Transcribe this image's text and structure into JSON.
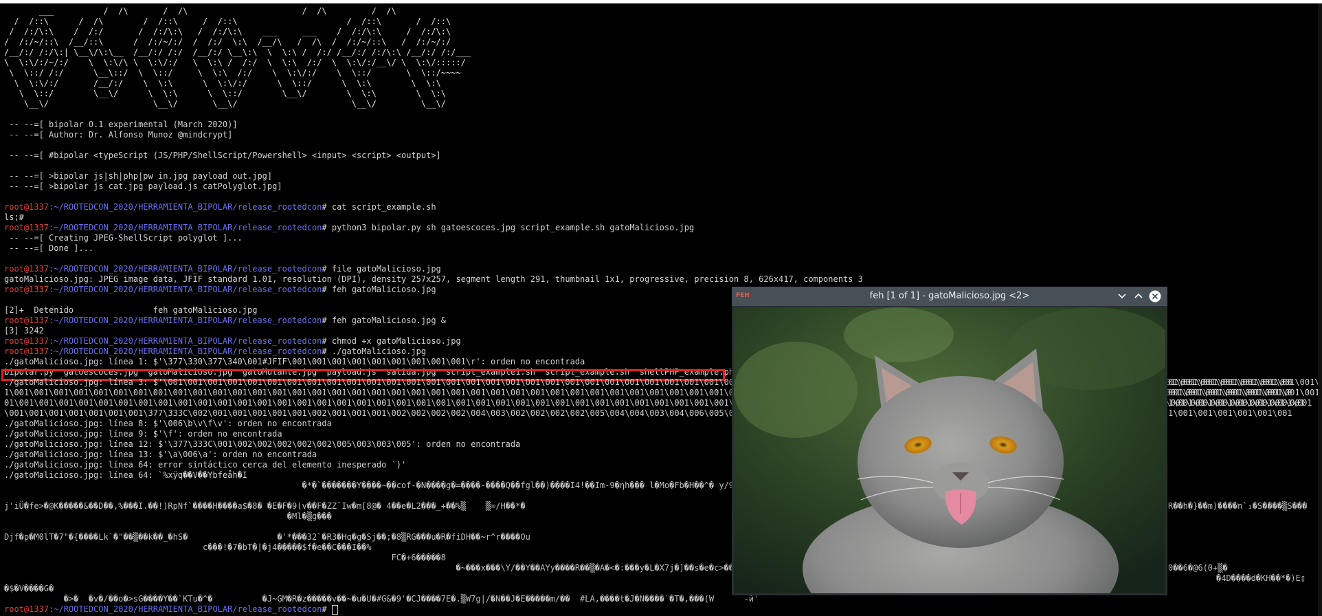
{
  "terminal": {
    "banner": [
      "       ___          /  /\\       /  /\\                       /  /\\         /  /\\",
      "  /  /::\\      /  /\\        /  /::\\     /  /::\\                      /  /::\\       /  /::\\",
      " /  /:/\\:\\    /  /:/       /  /:/\\:\\   /  /:/\\:\\    ___     ___    /  /:/\\:\\     /  /:/\\:\\",
      "/  /:/~/::\\  /__/::\\      /  /:/~/:/  /  /:/  \\:\\  /__/\\   /  /\\  /  /:/~/::\\   /  /:/~/:/",
      "/__/:/ /:/\\:| \\__\\/\\:\\__  /__/:/ /:/  /__/:/ \\__\\:\\  \\  \\:\\ /  /:/ /__/:/ /:/\\:\\ /__/:/ /:/___",
      "\\  \\:\\/:/~/:/    \\  \\:\\/\\ \\  \\:\\/:/   \\  \\:\\ /  /:/  \\  \\:\\  /:/  \\  \\:\\/:/__\\/ \\  \\:\\/:::::/",
      " \\  \\::/ /:/      \\__\\::/  \\  \\::/     \\  \\:\\  /:/    \\  \\:\\/:/    \\  \\::/       \\  \\::/~~~~",
      "  \\  \\:\\/:/       /__/:/    \\  \\:\\      \\  \\:\\/:/      \\  \\::/      \\  \\:\\        \\  \\:\\",
      "   \\  \\::/        \\__\\/      \\  \\:\\      \\  \\::/        \\__\\/        \\  \\:\\        \\  \\:\\",
      "    \\__\\/                     \\__\\/       \\__\\/                       \\__\\/         \\__\\/"
    ],
    "info": [
      " -- --=[ bipolar 0.1 experimental (March 2020)]",
      " -- --=[ Author: Dr. Alfonso Munoz @mindcrypt]",
      " -- --=[ #bipolar <typeScript (JS/PHP/ShellScript/Powershell> <input> <script> <output>]",
      " -- --=[ >bipolar js|sh|php|pw in.jpg payload out.jpg]",
      " -- --=[ >bipolar js cat.jpg payload.js catPolyglot.jpg]"
    ],
    "prompt_user": "root@1337",
    "prompt_path": ":~/ROOTEDCON_2020/HERRAMIENTA_BIPOLAR/release_rootedcon",
    "prompt_sign": "# ",
    "commands": [
      "cat script_example.sh",
      "python3 bipolar.py sh gatoescoces.jpg script_example.sh gatoMalicioso.jpg",
      "file gatoMalicioso.jpg",
      "feh gatoMalicioso.jpg",
      "feh gatoMalicioso.jpg &",
      "chmod +x gatoMalicioso.jpg",
      "./gatoMalicioso.jpg",
      ""
    ],
    "outputs": {
      "cat": "ls;#",
      "creating": " -- --=[ Creating JPEG-ShellScript polyglot ]...",
      "done": " -- --=[ Done ]...",
      "file": "gatoMalicioso.jpg: JPEG image data, JFIF standard 1.01, resolution (DPI), density 257x257, segment length 291, thumbnail 1x1, progressive, precision 8, 626x417, components 3",
      "stopped": "[2]+  Detenido                feh gatoMalicioso.jpg",
      "job": "[3] 3242",
      "line1": "./gatoMalicioso.jpg: línea 1: $'\\377\\330\\377\\340\\001#JFIF\\001\\001\\001\\001\\001\\001\\001\\001\\001\\r': orden no encontrada",
      "ls": "bipolar.py  gatoescoces.jpg  gatoMalicioso.jpg  gatoMutante.jpg  payload.js  salida.jpg  script_example1.sh  script_example.sh  shellPHP_example.php",
      "line3": "./gatoMalicioso.jpg: línea 3: $'\\001\\001\\001\\001\\001\\001\\001\\001\\001\\001\\001\\001\\001\\001\\001\\001\\001\\001\\001\\001\\001\\001\\001\\001\\001\\001\\001\\001\\001\\001\\001\\001\\001\\001\\001\\001\\001\\001\\001\\001\\001\\001\\001\\001\\001\\001\\001\\001\\001\\001\\001\\001\\001\\001\\001\\001\\001\\001\\001\\001\\001\\001\\001\\001\\001\\001\\001\\001\\001\\001\\001\\001",
      "oct1": "1\\001\\001\\001\\001\\001\\001\\001\\001\\001\\001\\001\\001\\001\\001\\001\\001\\001\\001\\001\\001\\001\\001\\001\\001\\001\\001\\001\\001\\001\\001\\001\\001\\001\\001\\001\\001\\001\\001\\001\\001\\001\\001\\001\\001\\001\\001\\001\\001\\001\\001\\001\\001\\001\\001\\001\\001\\001\\001\\001\\001\\001\\001\\001\\001\\001\\001\\001\\001\\001\\001",
      "oct2": "01\\001\\001\\001\\001\\001\\001\\001\\001\\001\\001\\001\\001\\001\\001\\001\\001\\001\\001\\001\\001\\001\\001\\001\\001\\001\\001\\001\\001\\001\\001\\001\\001\\001\\001\\001\\001\\001\\001\\001\\001\\001\\001\\001\\001\\001\\001\\001\\001\\001\\001\\001\\001\\001\\001\\001\\001\\001\\001\\001\\001\\001\\001\\001\\001\\001",
      "oct3": "\\001\\001\\001\\001\\001\\001\\001\\377\\333C\\002\\001\\001\\001\\001\\001\\002\\001\\001\\001\\002\\002\\002\\002\\004\\003\\002\\002\\002\\002\\005\\004\\004\\003\\004\\006\\005\\006\\006\\006\\005\\006\\006\\006\\007\\011\\010\\006\\007\\011\\007\\006\\006\\010\\013\\010\\011\\012\\012",
      "line8": "./gatoMalicioso.jpg: línea 8: $'\\006\\b\\v\\f\\v': orden no encontrada",
      "line9": "./gatoMalicioso.jpg: línea 9: $'\\f': orden no encontrada",
      "line12": "./gatoMalicioso.jpg: línea 12: $'\\377\\333C\\001\\002\\002\\002\\002\\002\\005\\003\\003\\005': orden no encontrada",
      "line13": "./gatoMalicioso.jpg: línea 13: $'\\a\\006\\a': orden no encontrada",
      "line64a": "./gatoMalicioso.jpg: línea 64: error sintáctico cerca del elemento inesperado `)'",
      "line64b": "./gatoMalicioso.jpg: línea 64: `%xÿq��V��Ybfeåh�I",
      "noise1": "                                                            �*�`�������Y����~��cof-�N����g�=����-����Q��fgl��)����I4!��Im-9�ηh��� l�Mo�Fb�H��^� y/9O�>i���ZV�2�¿�",
      "noise2": "j'iÜ�fe>�@K�����&��D��,%���I.��!)RpNf`����H����a$�8� �E�F�9(v��F�ZZ¯Iw�m[8@� 4��e�L2���_+��%▒    ▒∞/H��*�",
      "noise3": "                                                         �Ml�▒g���",
      "noise4": "Djf�p�M0lT�7\"�{����Lk`�\"��▒��k��_�hS�                  �'*���32`�R3�Hq�g�Sj��;�8▒RG���u�R�fiDH��~r^r����Ou",
      "noise5": "                                        c���!�7�bT�|�j4�����$f�e��C���I��%",
      "noise6": "                                                                              FC�+6�����8",
      "noise7": "                                                                                           �~���x���\\Y/��Y��AYy����R��▒�A�<�:���y�L�X7j�]��s�e�c>���'�_�'�vz�0��+",
      "noise8": "�$�V����G�",
      "noise9": "            �>�  �v�/��o�>sG����Y��`KTu�^�          �J~GM�R�z�����v��~�u�U�#G&�9'�CJ����7E�.▒W7g|/�N��J�E�����m/��  #LA,����t�J�N����`�T�,���(W      -й'",
      "right1": "01\\001\\001\\001\\001\\001\\00",
      "right2": "001\\001\\001\\001\\001\\001\\0",
      "right3": "1\\001\\001\\001\\001\\001\\001\\001",
      "right4": "1\\001\\001\\001\\001\\001\\001",
      "right5": "R��h�}��m)����n`₃�S����▒S���",
      "right6": "0��6�@6(0+▒�",
      "right7": "�4D����d�KH��*�)E▯"
    }
  },
  "feh_window": {
    "title": "feh [1 of 1] - gatoMalicioso.jpg <2>",
    "logo": "FEH",
    "minimize_icon": "chevron-down-icon",
    "maximize_icon": "chevron-up-icon",
    "close_icon": "close-icon"
  }
}
